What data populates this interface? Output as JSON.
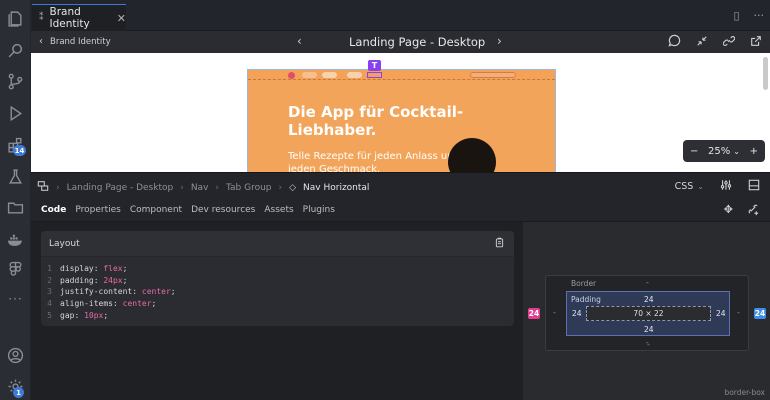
{
  "tab": {
    "label": "Brand Identity",
    "close": "✕"
  },
  "header": {
    "back_label": "Brand Identity",
    "title": "Landing Page - Desktop",
    "prev": "‹",
    "next": "›"
  },
  "canvas": {
    "hero_title": "Die App für Cocktail-Liebhaber.",
    "hero_subtitle": "Telle Rezepte für jeden Anlass und jeden Geschmack.",
    "text_marker": "T"
  },
  "zoom": {
    "minus": "−",
    "level": "25%",
    "caret": "⌄",
    "plus": "+"
  },
  "breadcrumb": {
    "items": [
      "Landing Page - Desktop",
      "Nav",
      "Tab Group"
    ],
    "current": "Nav Horizontal",
    "separator": "›"
  },
  "dev_header": {
    "language": "CSS",
    "language_caret": "⌄"
  },
  "subtabs": [
    "Code",
    "Properties",
    "Component",
    "Dev resources",
    "Assets",
    "Plugins"
  ],
  "code": {
    "title": "Layout",
    "lines": [
      {
        "num": "1",
        "prop": "display",
        "value": "flex"
      },
      {
        "num": "2",
        "prop": "padding",
        "value": "24px"
      },
      {
        "num": "3",
        "prop": "justify-content",
        "value": "center"
      },
      {
        "num": "4",
        "prop": "align-items",
        "value": "center"
      },
      {
        "num": "5",
        "prop": "gap",
        "value": "10px"
      }
    ]
  },
  "box_model": {
    "border_label": "Border",
    "border_values": {
      "top": "-",
      "right": "-",
      "bottom": "-",
      "left": "-"
    },
    "padding_label": "Padding",
    "padding_values": {
      "top": "24",
      "right": "24",
      "bottom": "24",
      "left": "24"
    },
    "content_size": "70 × 22",
    "gap_left": "24",
    "gap_right": "24",
    "bottom_extra": "-",
    "sizing": "border-box"
  },
  "badges": {
    "extensions": "14",
    "account": "1"
  },
  "colors": {
    "accent": "#3e7bd6",
    "frame": "#f2a45a",
    "code_value": "#e86aa8",
    "gap_left": "#e23d8f",
    "gap_right": "#3c8ee6"
  }
}
